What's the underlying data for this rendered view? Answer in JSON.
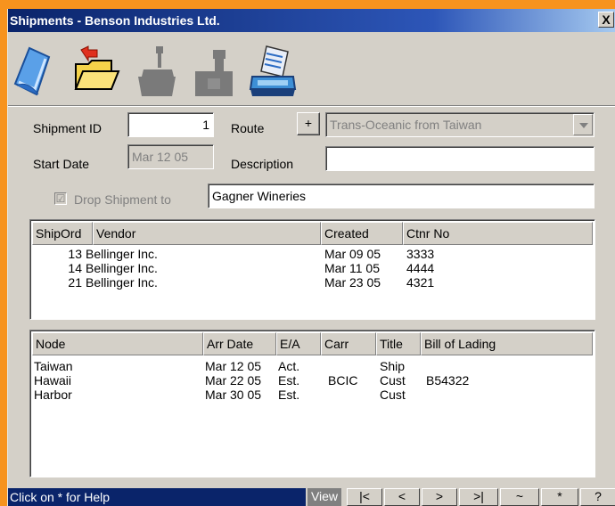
{
  "window": {
    "title": "Shipments - Benson Industries Ltd.",
    "close_glyph": "X"
  },
  "toolbar": {
    "icons": [
      "document-icon",
      "open-folder-icon",
      "weigh-scale-icon",
      "shipment-icon",
      "print-report-icon"
    ]
  },
  "form": {
    "shipment_id_label": "Shipment ID",
    "shipment_id_value": "1",
    "route_label": "Route",
    "route_add": "+",
    "route_value": "Trans-Oceanic from Taiwan",
    "start_date_label": "Start Date",
    "start_date_value": "Mar 12 05",
    "description_label": "Description",
    "description_value": "",
    "drop_shipment_label": "Drop Shipment to",
    "drop_shipment_check": "☑",
    "drop_shipment_value": "Gagner Wineries"
  },
  "orders": {
    "columns": [
      "ShipOrd",
      "Vendor",
      "Created",
      "Ctnr No"
    ],
    "rows": [
      {
        "shipord": "13",
        "vendor": "Bellinger Inc.",
        "created": "Mar 09 05",
        "ctnr": "3333"
      },
      {
        "shipord": "14",
        "vendor": "Bellinger Inc.",
        "created": "Mar 11 05",
        "ctnr": "4444"
      },
      {
        "shipord": "21",
        "vendor": "Bellinger Inc.",
        "created": "Mar 23 05",
        "ctnr": "4321"
      }
    ]
  },
  "nodes": {
    "columns": [
      "Node",
      "Arr Date",
      "E/A",
      "Carr",
      "Title",
      "Bill of Lading"
    ],
    "rows": [
      {
        "node": "Taiwan",
        "arr": "Mar 12 05",
        "ea": "Act.",
        "carr": "",
        "title": "Ship",
        "bol": ""
      },
      {
        "node": "Hawaii",
        "arr": "Mar 22 05",
        "ea": "Est.",
        "carr": "BCIC",
        "title": "Cust",
        "bol": "B54322"
      },
      {
        "node": "Harbor",
        "arr": "Mar 30 05",
        "ea": "Est.",
        "carr": "",
        "title": "Cust",
        "bol": ""
      }
    ]
  },
  "status": {
    "help_text": "Click on * for Help",
    "view": "View",
    "nav": [
      "|<",
      "<",
      ">",
      ">|",
      "~",
      "*",
      "?"
    ]
  }
}
